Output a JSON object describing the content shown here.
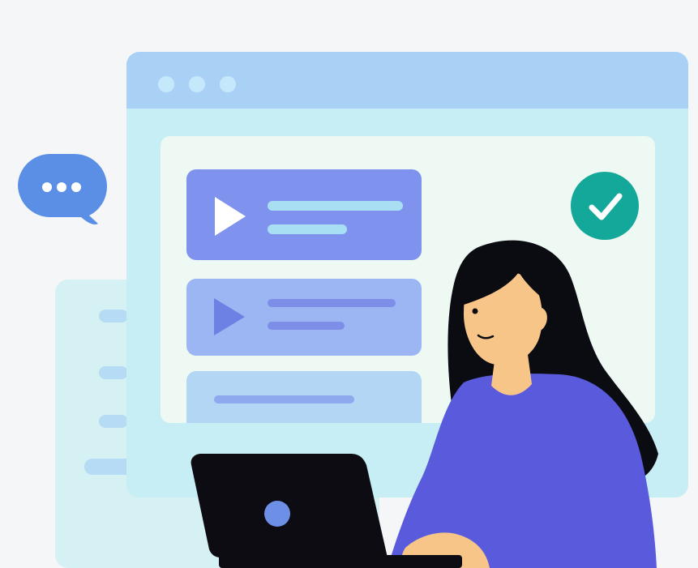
{
  "illustration": {
    "subject": "online-learning",
    "colors": {
      "page_background": "#f5f6f8",
      "window_body": "#c7eef4",
      "window_titlebar": "#a9d1f6",
      "window_dots": "#c6e8fb",
      "content_panel": "#eff9f3",
      "card_primary": "#7f93ee",
      "card_secondary": "#9bb6f2",
      "card_line": "#a9dff3",
      "check_badge": "#14a89a",
      "chat_bubble": "#5b8fe6",
      "back_panel": "#d6f1f4",
      "sweater": "#5a5bdc",
      "hair": "#0b0b12",
      "skin": "#f8c589",
      "laptop": "#0c0c12",
      "laptop_logo": "#6d8fe6"
    },
    "icons": [
      "chat-bubble-icon",
      "check-circle-icon",
      "play-icon",
      "laptop-icon"
    ],
    "video_cards": [
      {
        "kind": "play"
      },
      {
        "kind": "play"
      },
      {
        "kind": "text"
      }
    ]
  }
}
